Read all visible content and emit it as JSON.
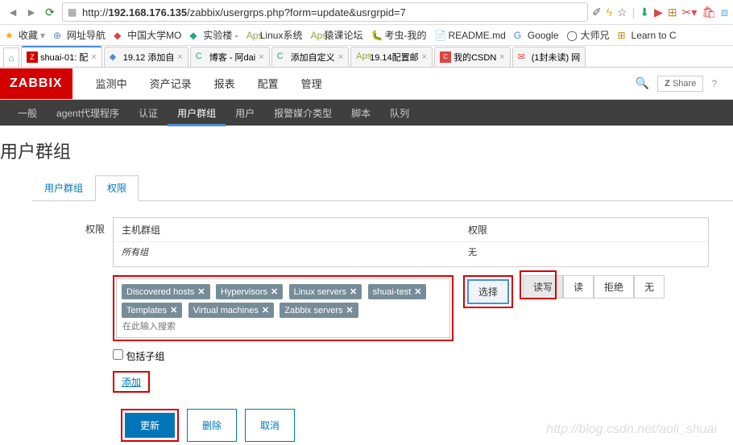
{
  "url": {
    "prefix": "http://",
    "host": "192.168.176.135",
    "path": "/zabbix/usergrps.php?form=update&usrgrpid=7"
  },
  "bookmarks": {
    "fav": "收藏",
    "items": [
      "网址导航",
      "中国大学MO",
      "实验楼 - ",
      "Linux系统",
      "猿课论坛",
      "考虫-我的",
      "README.md",
      "Google",
      "大师兄",
      "Learn to C"
    ]
  },
  "tabs": [
    {
      "label": "shuai-01: 配",
      "active": true
    },
    {
      "label": "19.12 添加自"
    },
    {
      "label": "博客 - 阿dai"
    },
    {
      "label": "添加自定义"
    },
    {
      "label": "19.14配置邮"
    },
    {
      "label": "我的CSDN"
    },
    {
      "label": "(1封未读) 网"
    }
  ],
  "zabbix": {
    "logo": "ZABBIX",
    "topmenu": [
      "监测中",
      "资产记录",
      "报表",
      "配置",
      "管理"
    ],
    "share": "Share",
    "submenu": [
      "一般",
      "agent代理程序",
      "认证",
      "用户群组",
      "用户",
      "报警媒介类型",
      "脚本",
      "队列"
    ],
    "submenu_active": 3
  },
  "page": {
    "title": "用户群组",
    "formtabs": {
      "t1": "用户群组",
      "t2": "权限"
    },
    "label_perm": "权限",
    "hostgroup_header": "主机群组",
    "perm_header": "权限",
    "all_groups": "所有组",
    "none": "无",
    "tags": [
      "Discovered hosts",
      "Hypervisors",
      "Linux servers",
      "shuai-test",
      "Templates",
      "Virtual machines",
      "Zabbix servers"
    ],
    "search_placeholder": "在此输入搜索",
    "btn_select": "选择",
    "btn_readwrite": "读写",
    "btn_read": "读",
    "btn_deny": "拒绝",
    "btn_none": "无",
    "include_sub": "包括子组",
    "add": "添加",
    "update": "更新",
    "delete": "删除",
    "cancel": "取消"
  },
  "watermark": "http://blog.csdn.net/aoli_shuai"
}
